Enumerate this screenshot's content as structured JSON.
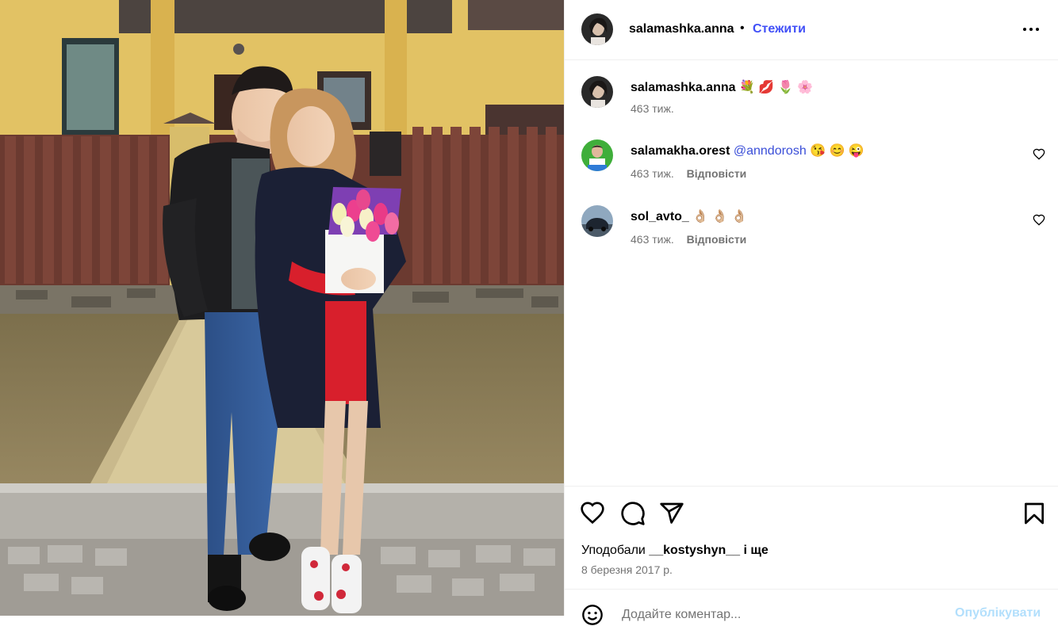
{
  "post": {
    "author": "salamashka.anna",
    "follow_label": "Стежити",
    "separator": "•"
  },
  "caption": {
    "user": "salamashka.anna",
    "text": "💐 💋 🌷 🌸",
    "time": "463 тиж."
  },
  "comments": [
    {
      "user": "salamakha.orest",
      "mention": "@anndorosh",
      "text": "😘 😊 😜",
      "time": "463 тиж.",
      "reply_label": "Відповісти"
    },
    {
      "user": "sol_avto_",
      "mention": "",
      "text": "👌🏼 👌🏼 👌🏼",
      "time": "463 тиж.",
      "reply_label": "Відповісти"
    }
  ],
  "likes": {
    "prefix": "Уподобали",
    "user": "__kostyshyn__",
    "suffix": "і ще"
  },
  "date": "8 березня 2017 р.",
  "add_comment": {
    "placeholder": "Додайте коментар...",
    "publish_label": "Опублікувати"
  },
  "icons": {
    "more": "more-horizontal-icon",
    "like": "heart-icon",
    "comment": "comment-bubble-icon",
    "share": "send-icon",
    "save": "bookmark-icon",
    "emoji": "emoji-icon"
  },
  "colors": {
    "follow": "#4150f7",
    "mention": "#3a4ed8",
    "muted": "#737373",
    "publish_disabled": "#b2dffc"
  }
}
